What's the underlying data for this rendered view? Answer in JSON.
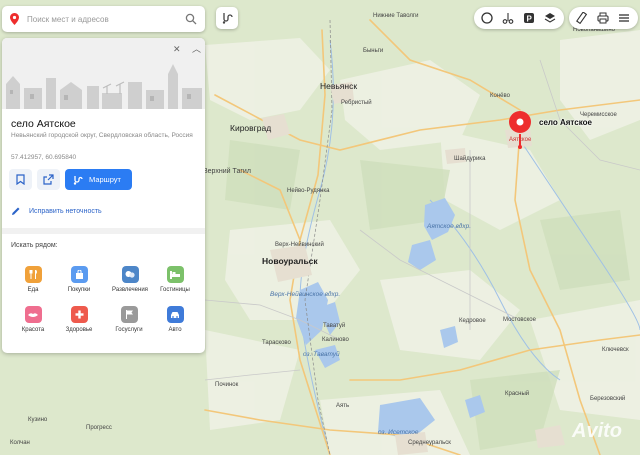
{
  "search": {
    "placeholder": "Поиск мест и адресов"
  },
  "place": {
    "title": "село Аятское",
    "address": "Невьянский городской округ, Свердловская область, Россия",
    "coords": "57.412957, 60.695840",
    "route_label": "Маршрут",
    "fix_label": "Исправить неточность"
  },
  "nearby": {
    "title": "Искать рядом:",
    "items": [
      {
        "label": "Еда",
        "color": "#f0a13a",
        "icon": "fork-knife-icon"
      },
      {
        "label": "Покупки",
        "color": "#5b9bf0",
        "icon": "bag-icon"
      },
      {
        "label": "Развлечения",
        "color": "#4d86c8",
        "icon": "masks-icon"
      },
      {
        "label": "Гостиницы",
        "color": "#7cc16a",
        "icon": "bed-icon"
      },
      {
        "label": "Красота",
        "color": "#ef6e8f",
        "icon": "lips-icon"
      },
      {
        "label": "Здоровье",
        "color": "#ee5a4d",
        "icon": "cross-icon"
      },
      {
        "label": "Госуслуги",
        "color": "#9a9a9a",
        "icon": "flag-icon"
      },
      {
        "label": "Авто",
        "color": "#3f7bd9",
        "icon": "car-icon"
      }
    ]
  },
  "map": {
    "marker_label": "село Аятское",
    "marker_sub": "Аятское",
    "labels": {
      "nizhnie_tavolgi": "Нижние Таволги",
      "novopashino": "Новопаньшино",
      "byngi": "Быньги",
      "nevyansk": "Невьянск",
      "rebristy": "Ребристый",
      "konevo": "Конёво",
      "cheremisskoe": "Черемисское",
      "kirovgrad": "Кировград",
      "shaydurikha": "Шайдурика",
      "verkhny_tagil": "Верхний Тагил",
      "neyvo_rudyanka": "Нейво-Рудянка",
      "ayatskoe_vdkhr": "Аятское вдхр.",
      "verkh_neyvinsky": "Верх-Нейвинский",
      "novouralsk": "Новоуральск",
      "verkh_neyvinskoe_vdkhr": "Верх-Нейвинское вдхр.",
      "tavatuy": "Таватуй",
      "tavatuy_lake": "оз. Таватуй",
      "kedrovoe": "Кедровое",
      "mostovskoe": "Мостовское",
      "tarasovo": "Тарасково",
      "kalinovo": "Калиново",
      "klyuchevsk": "Ключевск",
      "pochinok": "Починок",
      "krasny": "Красный",
      "berezovsky": "Березовский",
      "ayat": "Аять",
      "kuzino": "Кузино",
      "progress": "Прогресс",
      "isetskoe_lake": "оз. Исетское",
      "sredneuralsk": "Среднеуральск",
      "kolchan": "Колчан"
    },
    "forest_color": "#dde8cc",
    "field_color": "#eef1e4",
    "water_color": "#aac8ec",
    "road_color": "#f3c77a",
    "marker_color": "#ee2d2d",
    "brand_color": "#2b7cf3"
  }
}
